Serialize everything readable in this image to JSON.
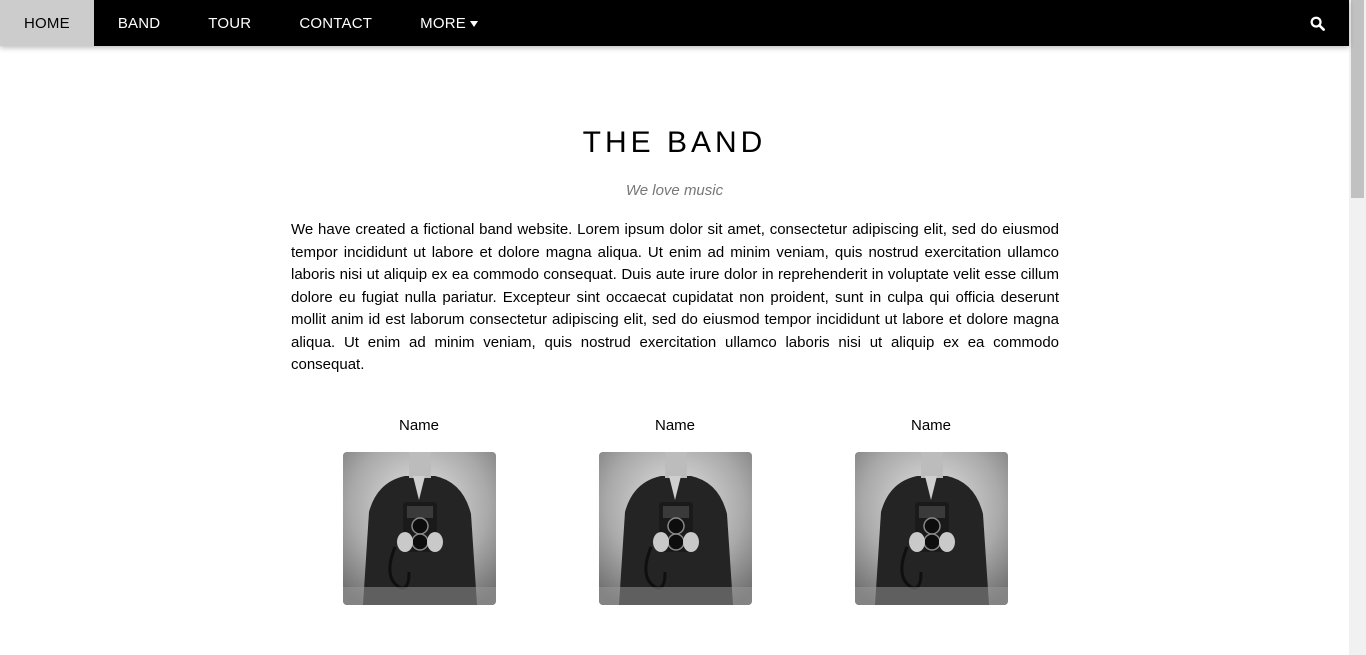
{
  "nav": {
    "items": [
      {
        "label": "HOME",
        "active": true
      },
      {
        "label": "BAND",
        "active": false
      },
      {
        "label": "TOUR",
        "active": false
      },
      {
        "label": "CONTACT",
        "active": false
      },
      {
        "label": "MORE",
        "active": false,
        "dropdown": true
      }
    ],
    "search_icon": "search-icon"
  },
  "band": {
    "title": "THE BAND",
    "subtitle": "We love music",
    "description": "We have created a fictional band website. Lorem ipsum dolor sit amet, consectetur adipiscing elit, sed do eiusmod tempor incididunt ut labore et dolore magna aliqua. Ut enim ad minim veniam, quis nostrud exercitation ullamco laboris nisi ut aliquip ex ea commodo consequat. Duis aute irure dolor in reprehenderit in voluptate velit esse cillum dolore eu fugiat nulla pariatur. Excepteur sint occaecat cupidatat non proident, sunt in culpa qui officia deserunt mollit anim id est laborum consectetur adipiscing elit, sed do eiusmod tempor incididunt ut labore et dolore magna aliqua. Ut enim ad minim veniam, quis nostrud exercitation ullamco laboris nisi ut aliquip ex ea commodo consequat."
  },
  "members": [
    {
      "name": "Name",
      "photo": "black-and-white photo of person holding vintage camera"
    },
    {
      "name": "Name",
      "photo": "black-and-white photo of person holding vintage camera"
    },
    {
      "name": "Name",
      "photo": "black-and-white photo of person holding vintage camera"
    }
  ],
  "colors": {
    "nav_bg": "#000000",
    "nav_active_bg": "#cccccc",
    "subtitle": "#777777"
  }
}
